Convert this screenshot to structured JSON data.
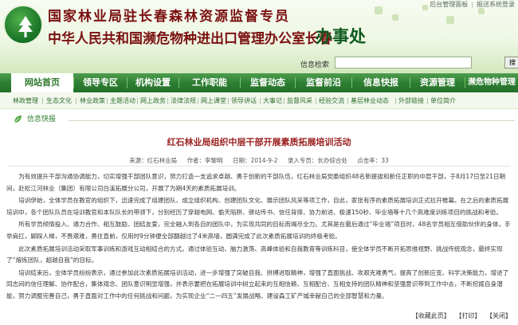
{
  "util": {
    "admin_label": "后台管理面板",
    "report_label": "报送系统登录"
  },
  "header": {
    "title_line1": "国家林业局驻长春森林资源监督专员",
    "title_line2": "中华人民共和国濒危物种进出口管理办公室长春",
    "office": "办事处",
    "search_label": "信息检索",
    "search_value": "",
    "search_button": "搜"
  },
  "nav": {
    "items": [
      {
        "label": "网站首页"
      },
      {
        "label": "领导专区"
      },
      {
        "label": "机构设置"
      },
      {
        "label": "工作职能"
      },
      {
        "label": "监督动态"
      },
      {
        "label": "监督前沿"
      },
      {
        "label": "信息快报"
      },
      {
        "label": "资源管理"
      },
      {
        "label": "濒危物种管理"
      }
    ]
  },
  "subnav": {
    "items": [
      "林政管理",
      "生态文化",
      "林业政策",
      "主题活动",
      "网上政务",
      "法律法规",
      "网上课堂",
      "领导讲话",
      "大事记",
      "监督风采",
      "经验交流",
      "基层林业动态",
      "外部链接",
      "单位简介"
    ]
  },
  "breadcrumb": {
    "label": "信息快报"
  },
  "article": {
    "title": "红石林业局组织中层干部开展素质拓展培训活动",
    "meta": {
      "source": "来源：红石林业局",
      "author": "作者：李黎明",
      "date": "日期：2014-9-2",
      "submitter": "录入专员：长办综合处",
      "views": "点击率：33"
    },
    "paragraphs": [
      "为有效提升干部沟通协调能力，切实增强干部团队意识，努力打造一支追求卓越、勇于创新的干部队伍，红石林业局党委组织48名新提拔和新任正职的中层干部，于8月17日至21日期间，赴松江河林业（集团）有限公司白溪拓展分公司，开展了为期4天的素质拓展培训。",
      "培训伊始，全体学员在教官的组织下，迅速完成了组建团队、成立组织机构、创建团队文化、展示团队风采等项工作，自此，家张有序的素质拓展培训正式拉开帷幕。在之后的素质拓展培训中，各个团队队员在培训教官和本队队长的带领下，分别经历了穿越电网、偷天陷阱、驿站传书、信任背摔、协力前进、极速150秒、毕业墙等十几个高难度训练项目的挑战和考验。",
      "所有学员倾情投入、通力合作、相互鼓励、团结友爱，完全融入到各自的团队中，为实现共同的目标而竭尽全力。尤其是在最后通过“毕业墙”项目时，48名学员相互借助伙伴的身体，手举肩扛，脚踩人梯，不畏艰难，勇往直前，仅用时9分钟便全部翻越过了4米高墙，圆满完成了此次素质拓展培训的终极考验。",
      "此次素质拓展培训活动采取军事训练和游戏互动相结合的方式。通过体验互动、脑力激荡、高峰体验和自我教育等训练科目，使全体学员不断开拓思维视野、挑战传统观念，最终实现了“熔炼团队，超越自我”的目标。",
      "培训结束后，全体学员纷纷表示，通过参加此次素质拓展培训活动，进一步增强了突破自我、拼搏进取精神，增强了直面挑战、攻艰克难勇气，提高了创新应变、科学决策能力，增进了同志间的信任理解、协作配合，集体观念、团队意识明显增强，并表示要把在拓展培训中树立起来的互相信赖、互相配合、互相支持的团队精神和坚强意识带到工作中去，不断挖掘自身潜能，努力调整完善自己，勇于直面对工作中的任何挑战和问题，为实现企业“二一四五”发展战略、建设森工矿产城幸献自己的全部智慧和力量。"
    ]
  },
  "footer": {
    "favorite": "【收藏此页】",
    "print": "【打印】",
    "close": "【关闭】"
  },
  "colors": {
    "nav_green": "#2f7f33",
    "title_red": "#7a1010",
    "office_green": "#0d5a1d",
    "article_title": "#9a2121"
  }
}
